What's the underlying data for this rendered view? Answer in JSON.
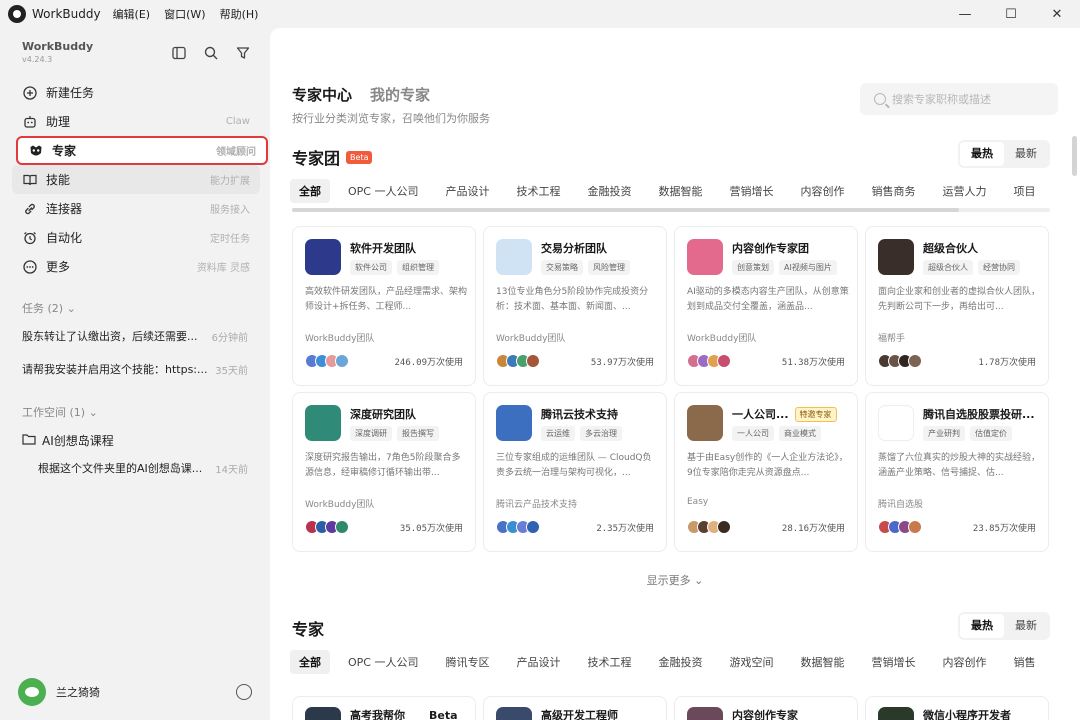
{
  "app": {
    "title": "WorkBuddy",
    "menus": [
      "编辑(E)",
      "窗口(W)",
      "帮助(H)"
    ],
    "window_controls": {
      "minimize": "—",
      "maximize": "☐",
      "close": "✕"
    }
  },
  "sidebar": {
    "brand_name": "WorkBuddy",
    "version": "v4.24.3",
    "nav": [
      {
        "label": "新建任务",
        "hint": "",
        "icon": "plus-circle-icon"
      },
      {
        "label": "助理",
        "hint": "Claw",
        "icon": "robot-icon"
      },
      {
        "label": "专家",
        "hint": "领域顾问",
        "icon": "expert-mask-icon"
      },
      {
        "label": "技能",
        "hint": "能力扩展",
        "icon": "book-icon"
      },
      {
        "label": "连接器",
        "hint": "服务接入",
        "icon": "link-icon"
      },
      {
        "label": "自动化",
        "hint": "定时任务",
        "icon": "alarm-clock-icon"
      },
      {
        "label": "更多",
        "hint": "资料库 灵感",
        "icon": "more-icon"
      }
    ],
    "tasks_header": "任务 (2)",
    "tasks": [
      {
        "text": "股东转让了认缴出资，后续还需要...",
        "time": "6分钟前"
      },
      {
        "text": "请帮我安装并启用这个技能：https:...",
        "time": "35天前"
      }
    ],
    "workspace_header": "工作空间 (1)",
    "workspace_folder": "AI创想岛课程",
    "workspace_item": {
      "text": "根据这个文件夹里的AI创想岛课...",
      "time": "14天前"
    },
    "user_name": "兰之猗猗"
  },
  "main": {
    "tab_active": "专家中心",
    "tab_inactive": "我的专家",
    "subtitle": "按行业分类浏览专家，召唤他们为你服务",
    "search_placeholder": "搜索专家职称或描述",
    "team_section": {
      "title": "专家团",
      "badge": "Beta",
      "sort": [
        "最热",
        "最新"
      ],
      "categories": [
        "全部",
        "OPC 一人公司",
        "产品设计",
        "技术工程",
        "金融投资",
        "数据智能",
        "营销增长",
        "内容创作",
        "销售商务",
        "运营人力",
        "项目"
      ]
    },
    "cards": [
      {
        "title": "软件开发团队",
        "tags": [
          "软件公司",
          "组织管理"
        ],
        "desc": "高效软件研发团队，产品经理需求、架构师设计+拆任务、工程师...",
        "author": "WorkBuddy团队",
        "usage": "246.09万次使用",
        "color": "#2d3a8c",
        "users": [
          "#5b7ad6",
          "#3f8ed8",
          "#e79a9a",
          "#6aa7d8"
        ],
        "hot": ""
      },
      {
        "title": "交易分析团队",
        "tags": [
          "交易策略",
          "风险管理"
        ],
        "desc": "13位专业角色分5阶段协作完成投资分析：技术面、基本面、新闻面、...",
        "author": "WorkBuddy团队",
        "usage": "53.97万次使用",
        "color": "#cfe3f4",
        "users": [
          "#c9873c",
          "#3c7ab8",
          "#4aa06a",
          "#a5553c"
        ],
        "hot": ""
      },
      {
        "title": "内容创作专家团",
        "tags": [
          "创意策划",
          "AI视频与图片"
        ],
        "desc": "AI驱动的多模态内容生产团队，从创意策划到成品交付全覆盖，涵盖品...",
        "author": "WorkBuddy团队",
        "usage": "51.38万次使用",
        "color": "#e36a8c",
        "users": [
          "#d56f8f",
          "#9c6cc4",
          "#e3a04f",
          "#c84e6f"
        ],
        "hot": ""
      },
      {
        "title": "超级合伙人",
        "tags": [
          "超级合伙人",
          "经营协同"
        ],
        "desc": "面向企业家和创业者的虚拟合伙人团队，先判断公司下一步，再给出可...",
        "author": "福帮手",
        "usage": "1.78万次使用",
        "color": "#3a2e2a",
        "users": [
          "#4a3a32",
          "#6a5447",
          "#302622",
          "#7d6353"
        ],
        "hot": ""
      },
      {
        "title": "深度研究团队",
        "tags": [
          "深度调研",
          "报告撰写"
        ],
        "desc": "深度研究报告输出，7角色5阶段聚合多源信息，经审稿修订循环输出带...",
        "author": "WorkBuddy团队",
        "usage": "35.05万次使用",
        "color": "#2f8a78",
        "users": [
          "#b8324f",
          "#2a5fa8",
          "#5e3aa0",
          "#2e8a6a"
        ],
        "hot": ""
      },
      {
        "title": "腾讯云技术支持",
        "tags": [
          "云运维",
          "多云治理"
        ],
        "desc": "三位专家组成的运维团队 — CloudQ负责多云统一治理与架构可视化，...",
        "author": "腾讯云产品技术支持",
        "usage": "2.35万次使用",
        "color": "#3c6fbf",
        "users": [
          "#4a72c4",
          "#3a8fd0",
          "#6a7dd6",
          "#2f62b0"
        ],
        "hot": ""
      },
      {
        "title": "一人公司...",
        "tags": [
          "一人公司",
          "商业模式"
        ],
        "desc": "基于由Easy创作的《一人企业方法论》，9位专家陪你走完从资源盘点...",
        "author": "Easy",
        "usage": "28.16万次使用",
        "color": "#8a6a4a",
        "users": [
          "#c89a6a",
          "#5a4030",
          "#e0b080",
          "#3a2a20"
        ],
        "hot": "特邀专家"
      },
      {
        "title": "腾讯自选股股票投研...",
        "tags": [
          "产业研判",
          "估值定价"
        ],
        "desc": "蒸馏了六位真实的炒股大神的实战经验，涵盖产业策略、信号捕捉、估...",
        "author": "腾讯自选股",
        "usage": "23.85万次使用",
        "color": "#ffffff",
        "users": [
          "#c94a4a",
          "#4a6ac9",
          "#8a4a8a",
          "#c97a4a"
        ],
        "hot": ""
      }
    ],
    "show_more": "显示更多",
    "expert_section": {
      "title": "专家",
      "sort": [
        "最热",
        "最新"
      ],
      "categories": [
        "全部",
        "OPC 一人公司",
        "腾讯专区",
        "产品设计",
        "技术工程",
        "金融投资",
        "游戏空间",
        "数据智能",
        "营销增长",
        "内容创作",
        "销售"
      ]
    },
    "partial_cards": [
      {
        "title": "高考我帮你",
        "badge": "Beta",
        "color": "#2b3a4a"
      },
      {
        "title": "高级开发工程师",
        "badge": "",
        "color": "#3a4a6a"
      },
      {
        "title": "内容创作专家",
        "badge": "",
        "color": "#6a4a5a"
      },
      {
        "title": "微信小程序开发者",
        "badge": "",
        "color": "#2a3a2a"
      }
    ]
  }
}
